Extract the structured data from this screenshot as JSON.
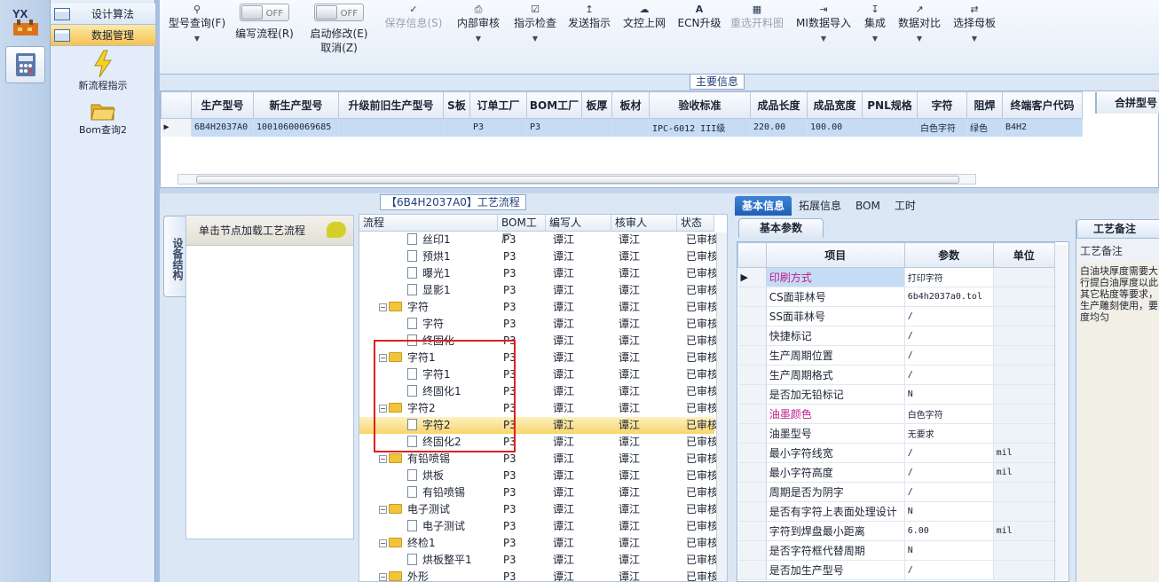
{
  "rail": {
    "logo": "YX",
    "logo_icon": "factory-logo-icon",
    "second_icon": "calculator-icon"
  },
  "nav": {
    "items": [
      {
        "label": "设计算法"
      },
      {
        "label": "数据管理"
      }
    ],
    "tiles": [
      {
        "label": "新流程指示",
        "icon": "lightning-icon"
      },
      {
        "label": "Bom查询2",
        "icon": "folder-open-icon"
      }
    ]
  },
  "toolbar": {
    "model_query": "型号查询(F)",
    "write_flow": "编写流程(R)",
    "start_modify": "启动修改(E)",
    "cancel": "取消(Z)",
    "toggle_off": "OFF",
    "save": "保存信息(S)",
    "internal_review": "内部审核",
    "instruction_check": "指示检查",
    "send_instruction": "发送指示",
    "doc_upload": "文控上网",
    "ecn_upgrade": "ECN升级",
    "cut_chart": "重选开料图",
    "mi_import": "MI数据导入",
    "integrate": "集成",
    "data_compare": "数据对比",
    "select_mother": "选择母板"
  },
  "main_info": {
    "title": "主要信息",
    "columns": [
      "生产型号",
      "新生产型号",
      "升级前旧生产型号",
      "S板",
      "订单工厂",
      "BOM工厂",
      "板厚",
      "板材",
      "验收标准",
      "成品长度",
      "成品宽度",
      "PNL规格",
      "字符",
      "阻焊",
      "终端客户代码"
    ],
    "row": [
      "6B4H2037A0",
      "10010600069685",
      "",
      "",
      "P3",
      "P3",
      "",
      "",
      "IPC-6012 III级",
      "220.00",
      "100.00",
      "",
      "白色字符",
      "绿色",
      "B4H2"
    ],
    "extra_header": "合拼型号"
  },
  "flow": {
    "title": "【6B4H2037A0】工艺流程",
    "side_tab": "设备结构",
    "left_header": "单击节点加载工艺流程",
    "columns": [
      "流程",
      "BOM工厂",
      "编写人",
      "核审人",
      "状态"
    ],
    "rows": [
      {
        "name": "丝印1",
        "type": "doc",
        "level": 2,
        "bom": "P3",
        "writer": "谭江",
        "reviewer": "谭江",
        "status": "已审核"
      },
      {
        "name": "预烘1",
        "type": "doc",
        "level": 2,
        "bom": "P3",
        "writer": "谭江",
        "reviewer": "谭江",
        "status": "已审核"
      },
      {
        "name": "曝光1",
        "type": "doc",
        "level": 2,
        "bom": "P3",
        "writer": "谭江",
        "reviewer": "谭江",
        "status": "已审核"
      },
      {
        "name": "显影1",
        "type": "doc",
        "level": 2,
        "bom": "P3",
        "writer": "谭江",
        "reviewer": "谭江",
        "status": "已审核"
      },
      {
        "name": "字符",
        "type": "folder",
        "level": 1,
        "bom": "P3",
        "writer": "谭江",
        "reviewer": "谭江",
        "status": "已审核"
      },
      {
        "name": "字符",
        "type": "doc",
        "level": 2,
        "bom": "P3",
        "writer": "谭江",
        "reviewer": "谭江",
        "status": "已审核"
      },
      {
        "name": "终固化",
        "type": "doc",
        "level": 2,
        "bom": "P3",
        "writer": "谭江",
        "reviewer": "谭江",
        "status": "已审核"
      },
      {
        "name": "字符1",
        "type": "folder",
        "level": 1,
        "bom": "P3",
        "writer": "谭江",
        "reviewer": "谭江",
        "status": "已审核"
      },
      {
        "name": "字符1",
        "type": "doc",
        "level": 2,
        "bom": "P3",
        "writer": "谭江",
        "reviewer": "谭江",
        "status": "已审核"
      },
      {
        "name": "终固化1",
        "type": "doc",
        "level": 2,
        "bom": "P3",
        "writer": "谭江",
        "reviewer": "谭江",
        "status": "已审核"
      },
      {
        "name": "字符2",
        "type": "folder",
        "level": 1,
        "bom": "P3",
        "writer": "谭江",
        "reviewer": "谭江",
        "status": "已审核"
      },
      {
        "name": "字符2",
        "type": "doc",
        "level": 2,
        "bom": "P3",
        "writer": "谭江",
        "reviewer": "谭江",
        "status": "已审核",
        "selected": true
      },
      {
        "name": "终固化2",
        "type": "doc",
        "level": 2,
        "bom": "P3",
        "writer": "谭江",
        "reviewer": "谭江",
        "status": "已审核"
      },
      {
        "name": "有铅喷锡",
        "type": "folder",
        "level": 1,
        "bom": "P3",
        "writer": "谭江",
        "reviewer": "谭江",
        "status": "已审核"
      },
      {
        "name": "烘板",
        "type": "doc",
        "level": 2,
        "bom": "P3",
        "writer": "谭江",
        "reviewer": "谭江",
        "status": "已审核"
      },
      {
        "name": "有铅喷锡",
        "type": "doc",
        "level": 2,
        "bom": "P3",
        "writer": "谭江",
        "reviewer": "谭江",
        "status": "已审核"
      },
      {
        "name": "电子测试",
        "type": "folder",
        "level": 1,
        "bom": "P3",
        "writer": "谭江",
        "reviewer": "谭江",
        "status": "已审核"
      },
      {
        "name": "电子测试",
        "type": "doc",
        "level": 2,
        "bom": "P3",
        "writer": "谭江",
        "reviewer": "谭江",
        "status": "已审核"
      },
      {
        "name": "终检1",
        "type": "folder",
        "level": 1,
        "bom": "P3",
        "writer": "谭江",
        "reviewer": "谭江",
        "status": "已审核"
      },
      {
        "name": "烘板整平1",
        "type": "doc",
        "level": 2,
        "bom": "P3",
        "writer": "谭江",
        "reviewer": "谭江",
        "status": "已审核"
      },
      {
        "name": "外形",
        "type": "folder",
        "level": 1,
        "bom": "P3",
        "writer": "谭江",
        "reviewer": "谭江",
        "status": "已审核"
      }
    ]
  },
  "right": {
    "tabs": [
      "基本信息",
      "拓展信息",
      "BOM",
      "工时"
    ],
    "basic_params": "基本参数",
    "columns": [
      "项目",
      "参数",
      "单位"
    ],
    "rows": [
      {
        "item": "印刷方式",
        "value": "打印字符",
        "unit": "",
        "pink": true,
        "current": true
      },
      {
        "item": "CS面菲林号",
        "value": "6b4h2037a0.tol",
        "unit": ""
      },
      {
        "item": "SS面菲林号",
        "value": "/",
        "unit": ""
      },
      {
        "item": "快捷标记",
        "value": "/",
        "unit": ""
      },
      {
        "item": "生产周期位置",
        "value": "/",
        "unit": ""
      },
      {
        "item": "生产周期格式",
        "value": "/",
        "unit": ""
      },
      {
        "item": "是否加无铅标记",
        "value": "N",
        "unit": ""
      },
      {
        "item": "油墨颜色",
        "value": "白色字符",
        "unit": "",
        "pink": true
      },
      {
        "item": "油墨型号",
        "value": "无要求",
        "unit": ""
      },
      {
        "item": "最小字符线宽",
        "value": "/",
        "unit": "mil"
      },
      {
        "item": "最小字符高度",
        "value": "/",
        "unit": "mil"
      },
      {
        "item": "周期是否为阴字",
        "value": "/",
        "unit": ""
      },
      {
        "item": "是否有字符上表面处理设计",
        "value": "N",
        "unit": ""
      },
      {
        "item": "字符到焊盘最小距离",
        "value": "6.00",
        "unit": "mil"
      },
      {
        "item": "是否字符框代替周期",
        "value": "N",
        "unit": ""
      },
      {
        "item": "是否加生产型号",
        "value": "/",
        "unit": ""
      }
    ],
    "remark_title": "工艺备注",
    "remark_sub": "工艺备注",
    "remark_text": "白油块厚度需要大\n行提白油厚度以此\n其它粘度等要求，\n生产雕刻使用，要\n度均匀"
  }
}
